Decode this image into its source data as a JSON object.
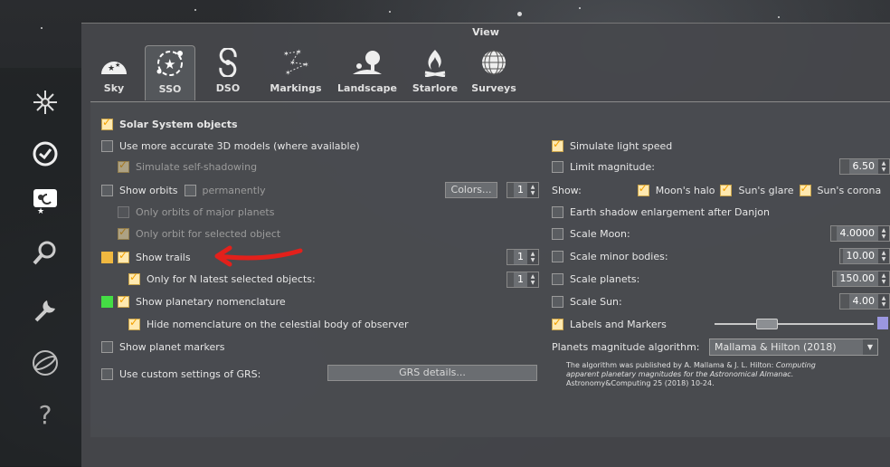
{
  "window": {
    "title": "View"
  },
  "tabs": [
    {
      "label": "Sky",
      "icon": "sky-icon"
    },
    {
      "label": "SSO",
      "icon": "sso-icon",
      "active": true
    },
    {
      "label": "DSO",
      "icon": "dso-icon"
    },
    {
      "label": "Markings",
      "icon": "markings-icon"
    },
    {
      "label": "Landscape",
      "icon": "landscape-icon"
    },
    {
      "label": "Starlore",
      "icon": "starlore-icon"
    },
    {
      "label": "Surveys",
      "icon": "surveys-icon"
    }
  ],
  "left_toolbar": [
    {
      "icon": "location-icon"
    },
    {
      "icon": "clock-icon"
    },
    {
      "icon": "view-icon"
    },
    {
      "icon": "search-icon"
    },
    {
      "icon": "wrench-icon"
    },
    {
      "icon": "telescope-icon"
    },
    {
      "icon": "help-icon"
    }
  ],
  "sso": {
    "solar_system_objects": "Solar System objects",
    "use_3d_models": "Use more accurate 3D models (where available)",
    "self_shadowing": "Simulate self-shadowing",
    "show_orbits": "Show orbits",
    "permanently": "permanently",
    "colors_button": "Colors...",
    "orbits_spin": "1",
    "orbits_major": "Only orbits of major planets",
    "orbit_selected": "Only orbit for selected object",
    "show_trails": "Show trails",
    "trails_spin": "1",
    "trails_latest": "Only for N latest selected objects:",
    "latest_spin": "1",
    "nomenclature": "Show planetary nomenclature",
    "hide_nomenclature": "Hide nomenclature on the celestial body of observer",
    "planet_markers": "Show planet markers",
    "custom_grs": "Use custom settings of GRS:",
    "grs_button": "GRS details...",
    "light_speed": "Simulate light speed",
    "limit_magnitude": "Limit magnitude:",
    "limit_magnitude_value": "6.50",
    "show_label": "Show:",
    "moons_halo": "Moon's halo",
    "suns_glare": "Sun's glare",
    "suns_corona": "Sun's corona",
    "earth_shadow": "Earth shadow enlargement after Danjon",
    "scale_moon": "Scale Moon:",
    "scale_moon_value": "4.0000",
    "scale_minor": "Scale minor bodies:",
    "scale_minor_value": "10.00",
    "scale_planets": "Scale planets:",
    "scale_planets_value": "150.00",
    "scale_sun": "Scale Sun:",
    "scale_sun_value": "4.00",
    "labels_markers": "Labels and Markers",
    "labels_markers_level": 0.3,
    "algorithm_label": "Planets magnitude algorithm:",
    "algorithm_value": "Mallama & Hilton (2018)",
    "note_plain": "The algorithm was published by A. Mallama & J. L. Hilton:",
    "note_italic_1": "Computing",
    "note_italic_2": "apparent planetary magnitudes for the Astronomical Almanac.",
    "note_ref": "Astronomy&Computing 25 (2018) 10-24."
  },
  "colors": {
    "trails_swatch": "#f0b840",
    "nomenclature_swatch": "#44dd44",
    "annotation_arrow": "#e3201b"
  }
}
